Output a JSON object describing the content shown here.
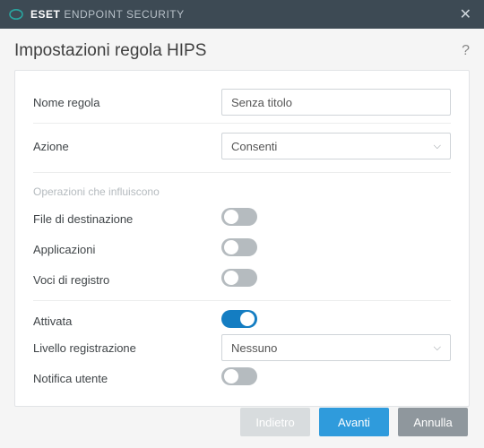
{
  "titlebar": {
    "brand_strong": "ESET",
    "brand_rest": "ENDPOINT SECURITY"
  },
  "header": {
    "title": "Impostazioni regola HIPS",
    "help": "?"
  },
  "fields": {
    "rule_name_label": "Nome regola",
    "rule_name_value": "Senza titolo",
    "action_label": "Azione",
    "action_value": "Consenti",
    "ops_section": "Operazioni che influiscono",
    "target_files_label": "File di destinazione",
    "applications_label": "Applicazioni",
    "registry_label": "Voci di registro",
    "enabled_label": "Attivata",
    "log_level_label": "Livello registrazione",
    "log_level_value": "Nessuno",
    "notify_label": "Notifica utente"
  },
  "toggles": {
    "target_files": false,
    "applications": false,
    "registry": false,
    "enabled": true,
    "notify": false
  },
  "footer": {
    "back": "Indietro",
    "next": "Avanti",
    "cancel": "Annulla"
  }
}
